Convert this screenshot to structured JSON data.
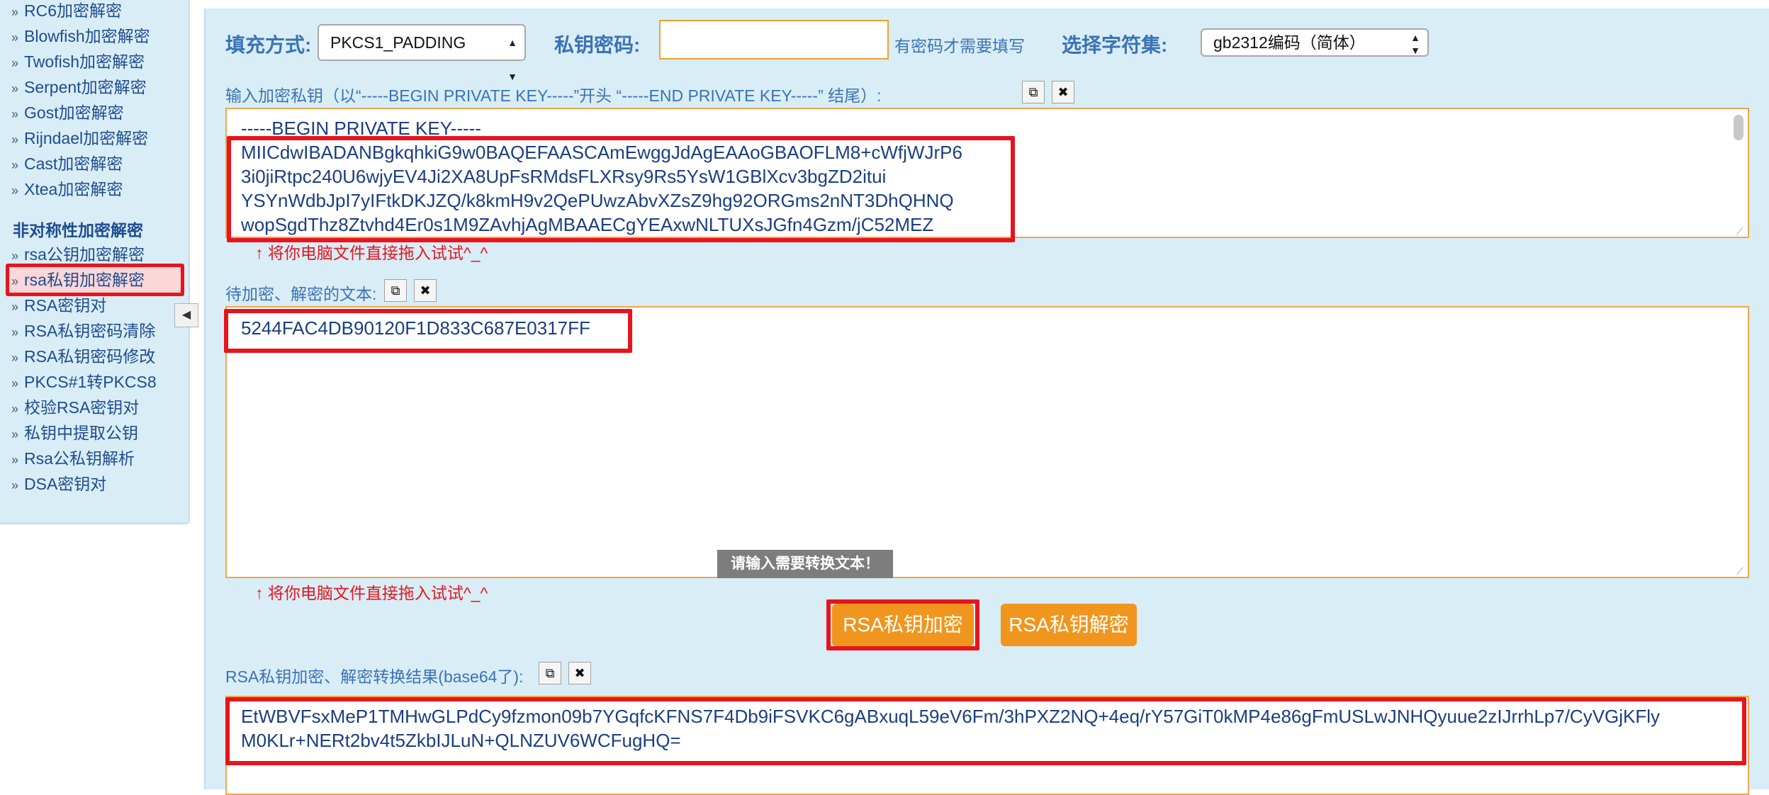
{
  "sidebar": {
    "items_top": [
      "RC6加密解密",
      "Blowfish加密解密",
      "Twofish加密解密",
      "Serpent加密解密",
      "Gost加密解密",
      "Rijndael加密解密",
      "Cast加密解密",
      "Xtea加密解密"
    ],
    "section_heading": "非对称性加密解密",
    "items_bottom": [
      "rsa公钥加密解密",
      "rsa私钥加密解密",
      "RSA密钥对",
      "RSA私钥密码清除",
      "RSA私钥密码修改",
      "PKCS#1转PKCS8",
      "校验RSA密钥对",
      "私钥中提取公钥",
      "Rsa公私钥解析",
      "DSA密钥对"
    ],
    "active_item": "rsa私钥加密解密"
  },
  "toolbar": {
    "padding_label": "填充方式:",
    "padding_value": "PKCS1_PADDING",
    "password_label": "私钥密码:",
    "password_value": "",
    "password_hint": "有密码才需要填写",
    "charset_label": "选择字符集:",
    "charset_value": "gb2312编码（简体）"
  },
  "key_section": {
    "label": "输入加密私钥（以“-----BEGIN PRIVATE KEY-----”开头 “-----END PRIVATE KEY-----” 结尾）:",
    "lines": [
      "-----BEGIN PRIVATE KEY-----",
      "MIICdwIBADANBgkqhkiG9w0BAQEFAASCAmEwggJdAgEAAoGBAOFLM8+cWfjWJrP6",
      "3i0jiRtpc240U6wjyEV4Ji2XA8UpFsRMdsFLXRsy9Rs5YsW1GBlXcv3bgZD2itui",
      "YSYnWdbJpI7yIFtkDKJZQ/k8kmH9v2QePUwzAbvXZsZ9hg92ORGms2nNT3DhQHNQ",
      "wopSgdThz8Ztvhd4Er0s1M9ZAvhjAgMBAAECgYEAxwNLTUXsJGfn4Gzm/jC52MEZ"
    ],
    "drop_hint": "↑ 将你电脑文件直接拖入试试^_^"
  },
  "text_section": {
    "label": "待加密、解密的文本:",
    "value": "5244FAC4DB90120F1D833C687E0317FF",
    "drop_hint": "↑ 将你电脑文件直接拖入试试^_^",
    "tooltip": "请输入需要转换文本！"
  },
  "actions": {
    "encrypt_label": "RSA私钥加密",
    "decrypt_label": "RSA私钥解密"
  },
  "result_section": {
    "label": "RSA私钥加密、解密转换结果(base64了):",
    "lines": [
      "EtWBVFsxMeP1TMHwGLPdCy9fzmon09b7YGqfcKFNS7F4Db9iFSVKC6gABxuqL59eV6Fm/3hPXZ2NQ+4eq/rY57GiT0kMP4e86gFmUSLwJNHQyuue2zIJrrhLp7/CyVGjKFly",
      "M0KLr+NERt2bv4t5ZkbIJLuN+QLNZUV6WCFugHQ="
    ]
  },
  "colors": {
    "panel_bg": "#d9edf7",
    "highlight_red": "#e8141c",
    "button_orange": "#f0961e",
    "label_blue": "#3a73b5"
  }
}
